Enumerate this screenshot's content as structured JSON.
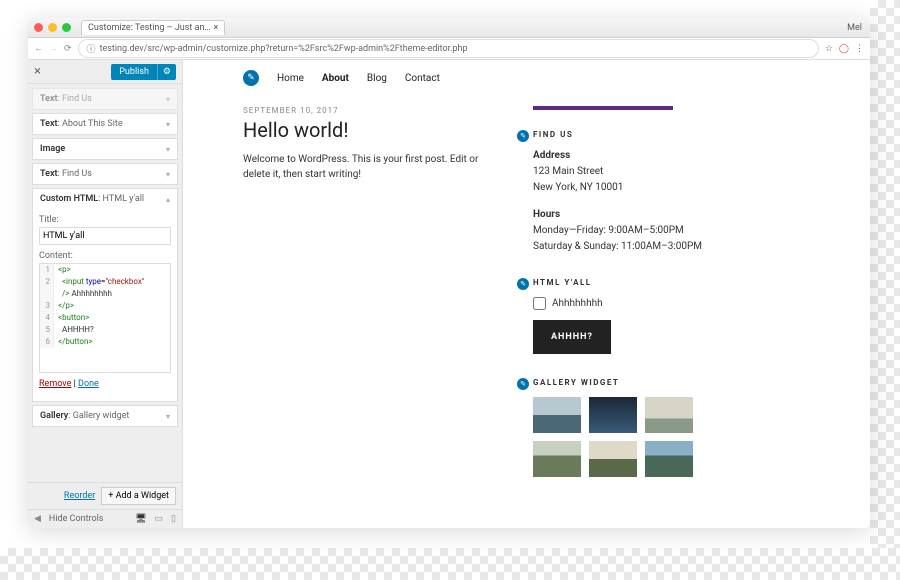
{
  "browser": {
    "tab_title": "Customize: Testing – Just an…",
    "user": "Mel",
    "url": "testing.dev/src/wp-admin/customize.php?return=%2Fsrc%2Fwp-admin%2Ftheme-editor.php"
  },
  "sidebar": {
    "publish": "Publish",
    "widgets": [
      {
        "type": "Text",
        "name": "Find Us"
      },
      {
        "type": "Text",
        "name": "About This Site"
      },
      {
        "type": "Image",
        "name": ""
      },
      {
        "type": "Text",
        "name": "Find Us"
      },
      {
        "type": "Custom HTML",
        "name": "HTML y'all"
      }
    ],
    "title_label": "Title:",
    "title_value": "HTML y'all",
    "content_label": "Content:",
    "code": [
      "<p>",
      "  <input type=\"checkbox\"",
      "  /> Ahhhhhhhh",
      "</p>",
      "<button>",
      "  AHHHH?",
      "</button>"
    ],
    "remove": "Remove",
    "done": "Done",
    "gallery": {
      "type": "Gallery",
      "name": "Gallery widget"
    },
    "reorder": "Reorder",
    "add": "Add a Widget",
    "hide": "Hide Controls"
  },
  "preview": {
    "nav": [
      "Home",
      "About",
      "Blog",
      "Contact"
    ],
    "post": {
      "date": "SEPTEMBER 10, 2017",
      "title": "Hello world!",
      "body": "Welcome to WordPress. This is your first post. Edit or delete it, then start writing!"
    },
    "findus": {
      "title": "FIND US",
      "addr_lbl": "Address",
      "addr1": "123 Main Street",
      "addr2": "New York, NY 10001",
      "hours_lbl": "Hours",
      "hours1": "Monday—Friday: 9:00AM–5:00PM",
      "hours2": "Saturday & Sunday: 11:00AM–3:00PM"
    },
    "html": {
      "title": "HTML Y'ALL",
      "checkbox": "Ahhhhhhhh",
      "button": "AHHHH?"
    },
    "gallery": {
      "title": "GALLERY WIDGET"
    }
  }
}
